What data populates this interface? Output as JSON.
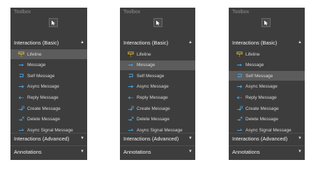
{
  "colors": {
    "panel_bg": "#3d3d3d",
    "selected_bg": "#5c5c5c",
    "icon_blue": "#4aa3df",
    "icon_yellow": "#e8c229",
    "text": "#d8d8d8"
  },
  "panels": [
    {
      "title": "Toolbox",
      "basic_header": "Interactions (Basic)",
      "items": [
        {
          "label": "Lifeline",
          "icon": "lifeline-icon"
        },
        {
          "label": "Message",
          "icon": "message-icon"
        },
        {
          "label": "Self Message",
          "icon": "self-message-icon"
        },
        {
          "label": "Async Message",
          "icon": "async-message-icon"
        },
        {
          "label": "Reply Message",
          "icon": "reply-message-icon"
        },
        {
          "label": "Create Message",
          "icon": "create-message-icon"
        },
        {
          "label": "Delete Message",
          "icon": "delete-message-icon"
        },
        {
          "label": "Async Signal Message",
          "icon": "async-signal-message-icon"
        }
      ],
      "selected": "Lifeline",
      "advanced_header": "Interactions (Advanced)",
      "annotations_header": "Annotations"
    },
    {
      "title": "Toolbox",
      "basic_header": "Interactions (Basic)",
      "items": [
        {
          "label": "Lifeline",
          "icon": "lifeline-icon"
        },
        {
          "label": "Message",
          "icon": "message-icon"
        },
        {
          "label": "Self Message",
          "icon": "self-message-icon"
        },
        {
          "label": "Async Message",
          "icon": "async-message-icon"
        },
        {
          "label": "Reply Message",
          "icon": "reply-message-icon"
        },
        {
          "label": "Create Message",
          "icon": "create-message-icon"
        },
        {
          "label": "Delete Message",
          "icon": "delete-message-icon"
        },
        {
          "label": "Async Signal Message",
          "icon": "async-signal-message-icon"
        }
      ],
      "selected": "Message",
      "advanced_header": "Interactions (Advanced)",
      "annotations_header": "Annotations"
    },
    {
      "title": "Toolbox",
      "basic_header": "Interactions (Basic)",
      "items": [
        {
          "label": "Lifeline",
          "icon": "lifeline-icon"
        },
        {
          "label": "Message",
          "icon": "message-icon"
        },
        {
          "label": "Self Message",
          "icon": "self-message-icon"
        },
        {
          "label": "Async Message",
          "icon": "async-message-icon"
        },
        {
          "label": "Reply Message",
          "icon": "reply-message-icon"
        },
        {
          "label": "Create Message",
          "icon": "create-message-icon"
        },
        {
          "label": "Delete Message",
          "icon": "delete-message-icon"
        },
        {
          "label": "Async Signal Message",
          "icon": "async-signal-message-icon"
        }
      ],
      "selected": "Self Message",
      "advanced_header": "Interactions (Advanced)",
      "annotations_header": "Annotations"
    }
  ]
}
